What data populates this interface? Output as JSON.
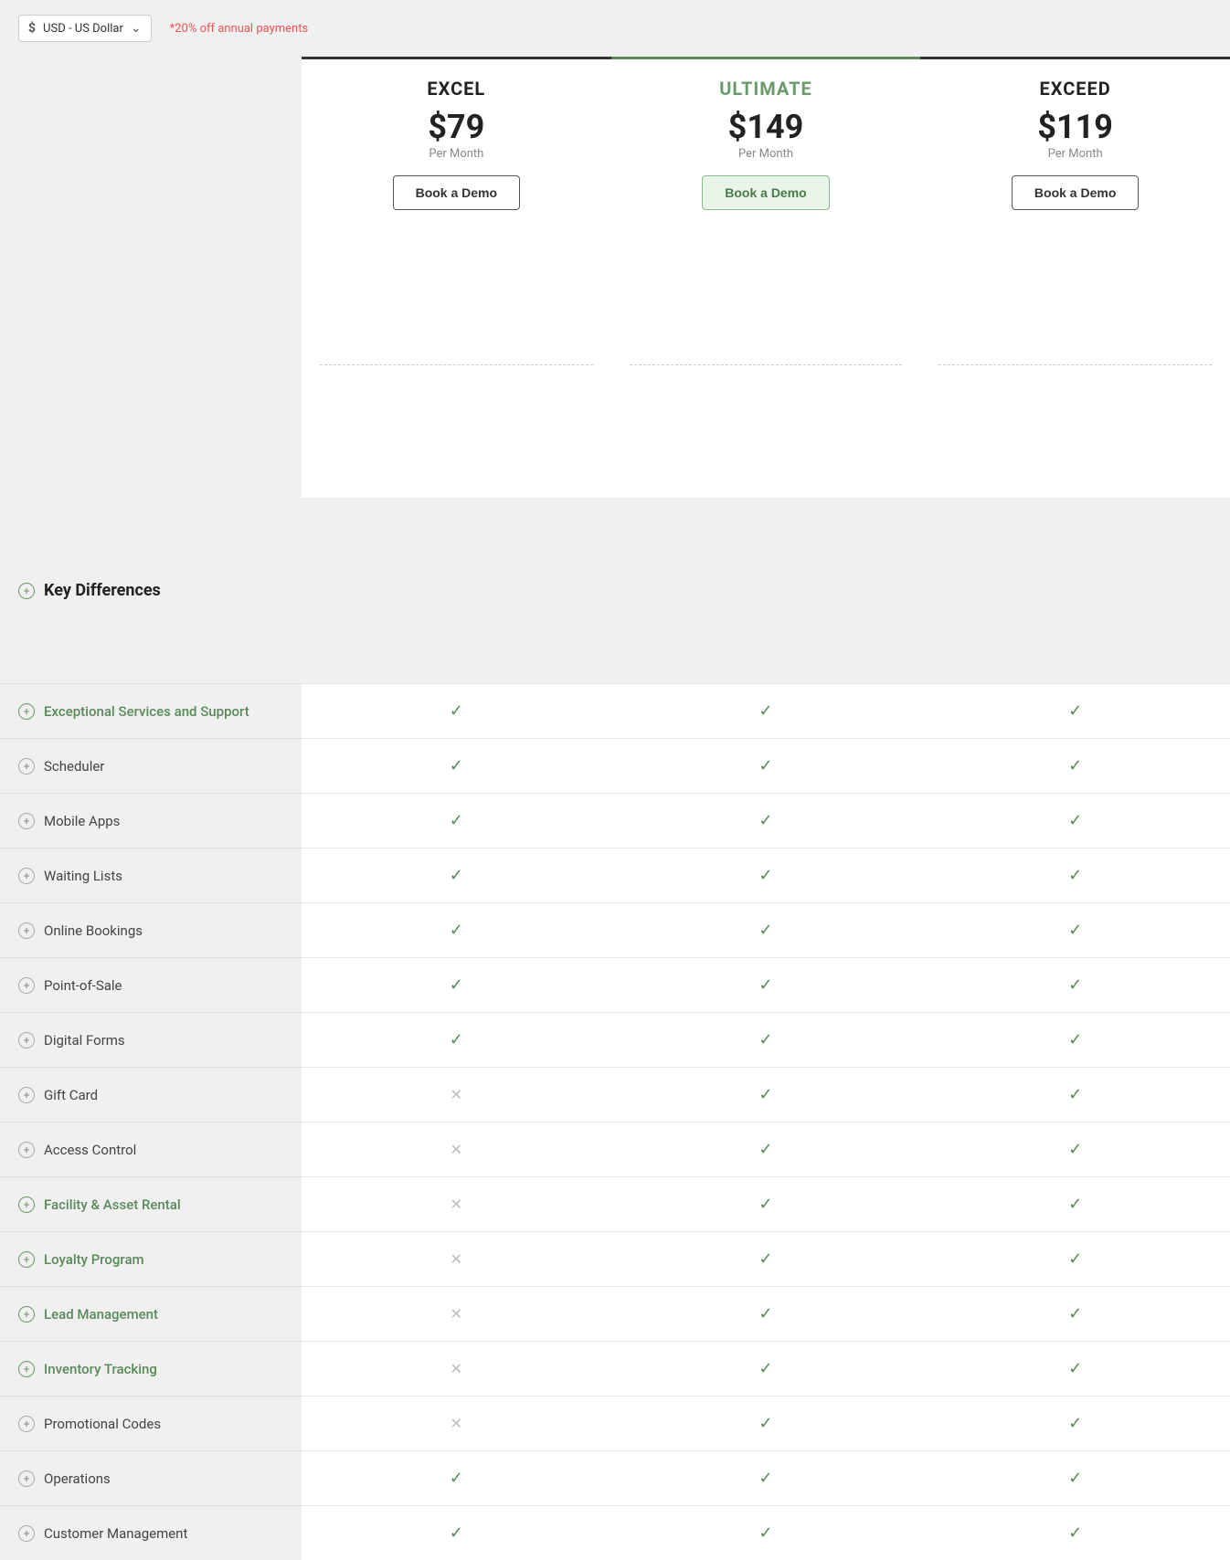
{
  "currency": {
    "symbol": "$",
    "label": "USD - US Dollar",
    "discount_note": "*20% off annual payments"
  },
  "plans": [
    {
      "id": "excel",
      "name": "EXCEL",
      "price": "$79",
      "period": "Per Month",
      "btn_label": "Book a Demo",
      "style": "excel"
    },
    {
      "id": "ultimate",
      "name": "ULTIMATE",
      "price": "$149",
      "period": "Per Month",
      "btn_label": "Book a Demo",
      "style": "ultimate"
    },
    {
      "id": "exceed",
      "name": "EXCEED",
      "price": "$119",
      "period": "Per Month",
      "btn_label": "Book a Demo",
      "style": "exceed"
    }
  ],
  "section_title": "Key Differences",
  "features": [
    {
      "name": "Exceptional Services and Support",
      "style": "green",
      "plus_green": true,
      "excel": "check",
      "ultimate": "check",
      "exceed": "check"
    },
    {
      "name": "Scheduler",
      "style": "normal",
      "plus_green": false,
      "excel": "check",
      "ultimate": "check",
      "exceed": "check"
    },
    {
      "name": "Mobile Apps",
      "style": "normal",
      "plus_green": false,
      "excel": "check",
      "ultimate": "check",
      "exceed": "check"
    },
    {
      "name": "Waiting Lists",
      "style": "normal",
      "plus_green": false,
      "excel": "check",
      "ultimate": "check",
      "exceed": "check"
    },
    {
      "name": "Online Bookings",
      "style": "normal",
      "plus_green": false,
      "excel": "check",
      "ultimate": "check",
      "exceed": "check"
    },
    {
      "name": "Point-of-Sale",
      "style": "normal",
      "plus_green": false,
      "excel": "check",
      "ultimate": "check",
      "exceed": "check"
    },
    {
      "name": "Digital Forms",
      "style": "normal",
      "plus_green": false,
      "excel": "check",
      "ultimate": "check",
      "exceed": "check"
    },
    {
      "name": "Gift Card",
      "style": "normal",
      "plus_green": false,
      "excel": "x",
      "ultimate": "check",
      "exceed": "check"
    },
    {
      "name": "Access Control",
      "style": "normal",
      "plus_green": false,
      "excel": "x",
      "ultimate": "check",
      "exceed": "check"
    },
    {
      "name": "Facility & Asset Rental",
      "style": "green",
      "plus_green": true,
      "excel": "x",
      "ultimate": "check",
      "exceed": "check"
    },
    {
      "name": "Loyalty Program",
      "style": "green",
      "plus_green": true,
      "excel": "x",
      "ultimate": "check",
      "exceed": "check"
    },
    {
      "name": "Lead Management",
      "style": "green",
      "plus_green": true,
      "excel": "x",
      "ultimate": "check",
      "exceed": "check"
    },
    {
      "name": "Inventory Tracking",
      "style": "green",
      "plus_green": true,
      "excel": "x",
      "ultimate": "check",
      "exceed": "check"
    },
    {
      "name": "Promotional Codes",
      "style": "normal",
      "plus_green": false,
      "excel": "x",
      "ultimate": "check",
      "exceed": "check"
    },
    {
      "name": "Operations",
      "style": "normal",
      "plus_green": false,
      "excel": "check",
      "ultimate": "check",
      "exceed": "check"
    },
    {
      "name": "Customer Management",
      "style": "normal",
      "plus_green": false,
      "excel": "check",
      "ultimate": "check",
      "exceed": "check"
    }
  ]
}
